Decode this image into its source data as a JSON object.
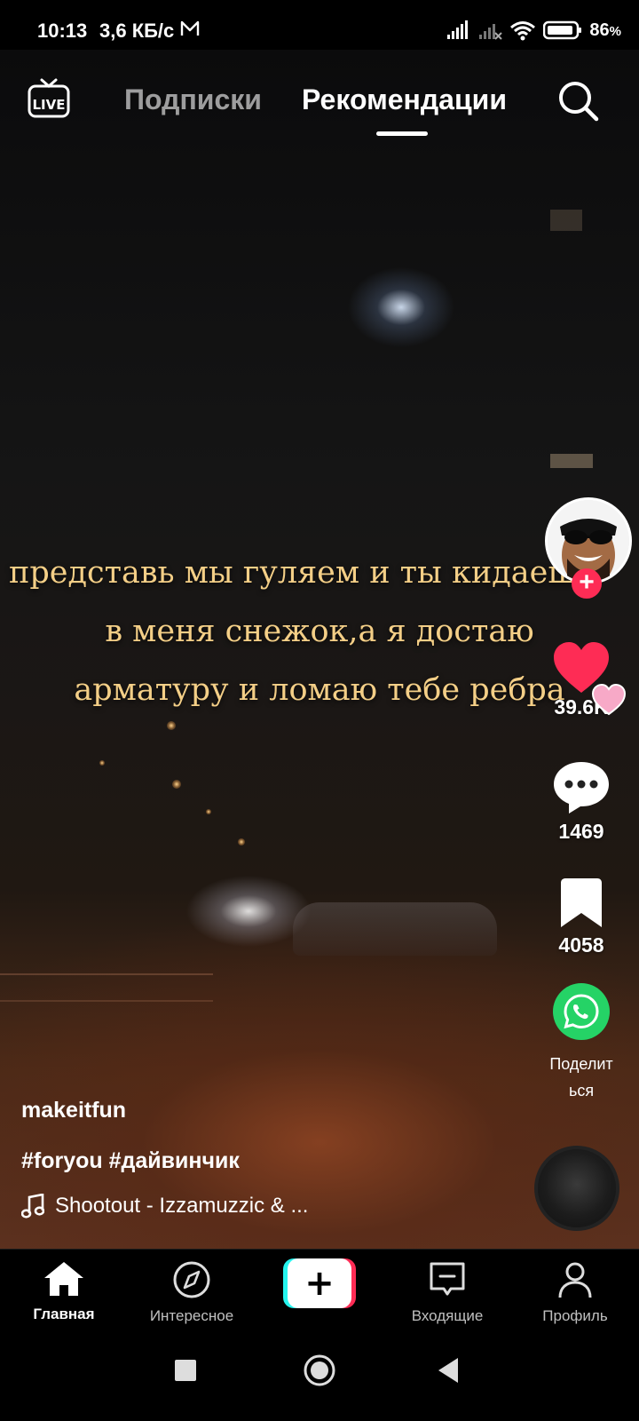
{
  "status_bar": {
    "time": "10:13",
    "data_speed": "3,6 КБ/с",
    "battery": "86",
    "battery_unit": "%"
  },
  "top_nav": {
    "live_label": "LIVE",
    "tab_following": "Подписки",
    "tab_for_you": "Рекомендации",
    "active_tab": "Рекомендации"
  },
  "video": {
    "overlay_text_lines": [
      "представь мы гуляем и ты кидаешь",
      "в меня снежок,а я достаю",
      "арматуру и ломаю тебе ребра"
    ]
  },
  "actions": {
    "likes": "39.6K",
    "comments": "1469",
    "favorites": "4058",
    "share_label_line1": "Поделит",
    "share_label_line2": "ься"
  },
  "post": {
    "username": "makeitfun",
    "description": "#foryou #дайвинчик",
    "music": "Shootout - Izzamuzzic & ..."
  },
  "bottom_nav": {
    "home": "Главная",
    "discover": "Интересное",
    "create": "+",
    "inbox": "Входящие",
    "profile": "Профиль",
    "active": "Главная"
  },
  "colors": {
    "accent_red": "#fe2c55",
    "accent_cyan": "#25f4ee",
    "overlay_text": "#f4cf87",
    "whatsapp_green": "#25d366"
  }
}
